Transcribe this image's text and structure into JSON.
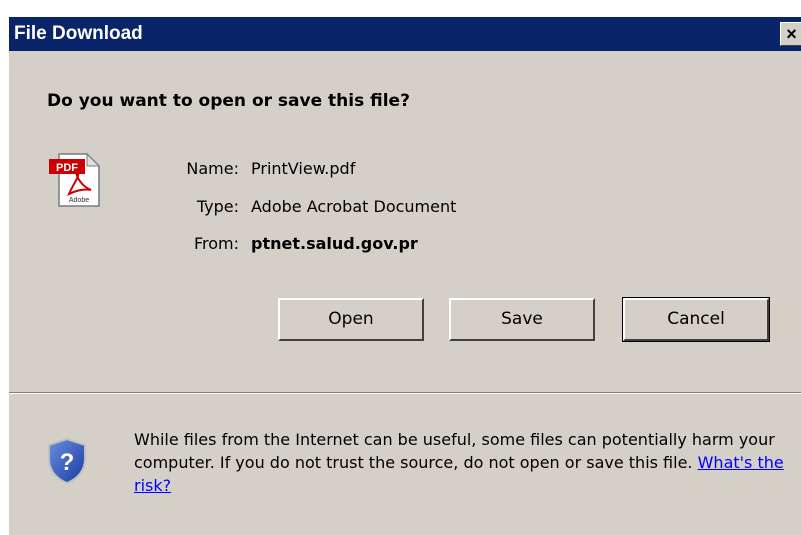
{
  "window": {
    "title": "File Download",
    "close_glyph": "×"
  },
  "dialog": {
    "question": "Do you want to open or save this file?",
    "file_icon": "pdf-file-icon",
    "file_icon_badge": "PDF",
    "file_icon_brand": "Adobe",
    "info": {
      "name_label": "Name:",
      "name_value": "PrintView.pdf",
      "type_label": "Type:",
      "type_value": "Adobe Acrobat Document",
      "from_label": "From:",
      "from_value": "ptnet.salud.gov.pr"
    },
    "buttons": {
      "open": "Open",
      "save": "Save",
      "cancel": "Cancel"
    },
    "warning": {
      "icon": "security-shield-question-icon",
      "text": "While files from the Internet can be useful, some files can potentially harm your computer. If you do not trust the source, do not open or save this file.",
      "link": "What's the risk?"
    }
  },
  "colors": {
    "titlebar": "#0a246a",
    "face": "#d4d0c8",
    "link": "#0000ff",
    "pdf_red": "#cc0000"
  }
}
